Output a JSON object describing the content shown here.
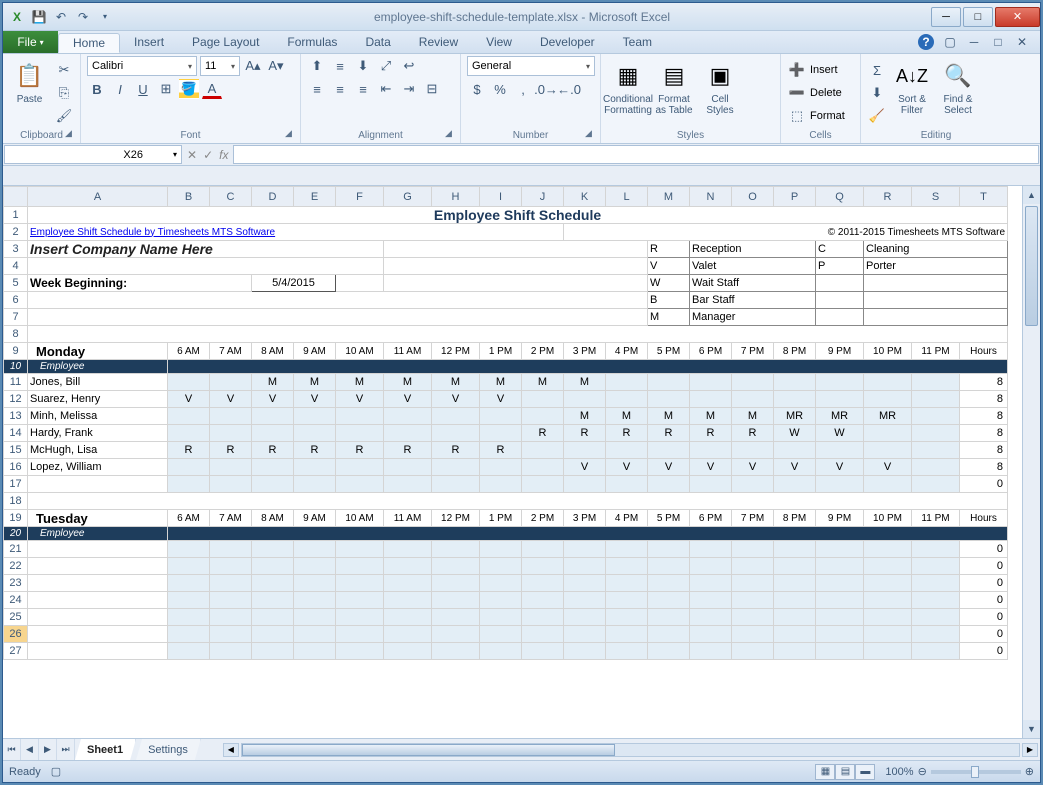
{
  "app": {
    "title": "employee-shift-schedule-template.xlsx - Microsoft Excel"
  },
  "ribbon": {
    "file": "File",
    "tabs": [
      "Home",
      "Insert",
      "Page Layout",
      "Formulas",
      "Data",
      "Review",
      "View",
      "Developer",
      "Team"
    ],
    "active": "Home",
    "clipboard_label": "Clipboard",
    "paste_label": "Paste",
    "font_label": "Font",
    "font_name": "Calibri",
    "font_size": "11",
    "alignment_label": "Alignment",
    "number_label": "Number",
    "number_format": "General",
    "styles_label": "Styles",
    "cond_fmt": "Conditional\nFormatting",
    "fmt_table": "Format\nas Table",
    "cell_styles": "Cell\nStyles",
    "cells_label": "Cells",
    "insert": "Insert",
    "delete": "Delete",
    "format": "Format",
    "editing_label": "Editing",
    "sortfilter": "Sort &\nFilter",
    "findselect": "Find &\nSelect"
  },
  "namebox": "X26",
  "sheet_tabs": [
    "Sheet1",
    "Settings"
  ],
  "status": {
    "ready": "Ready",
    "zoom": "100%"
  },
  "cols": [
    "A",
    "B",
    "C",
    "D",
    "E",
    "F",
    "G",
    "H",
    "I",
    "J",
    "K",
    "L",
    "M",
    "N",
    "O",
    "P",
    "Q",
    "R",
    "S",
    "T"
  ],
  "doc": {
    "title": "Employee Shift Schedule",
    "link": "Employee Shift Schedule by Timesheets MTS Software",
    "copyright": "© 2011-2015 Timesheets MTS Software",
    "company": "Insert Company Name Here",
    "week_label": "Week Beginning:",
    "week_date": "5/4/2015",
    "legend": [
      {
        "c": "R",
        "n": "Reception",
        "c2": "C",
        "n2": "Cleaning"
      },
      {
        "c": "V",
        "n": "Valet",
        "c2": "P",
        "n2": "Porter"
      },
      {
        "c": "W",
        "n": "Wait Staff",
        "c2": "",
        "n2": ""
      },
      {
        "c": "B",
        "n": "Bar Staff",
        "c2": "",
        "n2": ""
      },
      {
        "c": "M",
        "n": "Manager",
        "c2": "",
        "n2": ""
      }
    ],
    "times": [
      "6 AM",
      "7 AM",
      "8 AM",
      "9 AM",
      "10 AM",
      "11 AM",
      "12 PM",
      "1 PM",
      "2 PM",
      "3 PM",
      "4 PM",
      "5 PM",
      "6 PM",
      "7 PM",
      "8 PM",
      "9 PM",
      "10 PM",
      "11 PM"
    ],
    "hours_label": "Hours",
    "employee_label": "Employee",
    "days": [
      {
        "name": "Monday",
        "rows": [
          {
            "n": "Jones, Bill",
            "s": [
              "",
              "",
              "M",
              "M",
              "M",
              "M",
              "M",
              "M",
              "M",
              "M",
              "",
              "",
              "",
              "",
              "",
              "",
              "",
              ""
            ],
            "h": "8"
          },
          {
            "n": "Suarez, Henry",
            "s": [
              "V",
              "V",
              "V",
              "V",
              "V",
              "V",
              "V",
              "V",
              "",
              "",
              "",
              "",
              "",
              "",
              "",
              "",
              "",
              ""
            ],
            "h": "8"
          },
          {
            "n": "Minh, Melissa",
            "s": [
              "",
              "",
              "",
              "",
              "",
              "",
              "",
              "",
              "",
              "M",
              "M",
              "M",
              "M",
              "M",
              "MR",
              "MR",
              "MR",
              ""
            ],
            "h": "8"
          },
          {
            "n": "Hardy, Frank",
            "s": [
              "",
              "",
              "",
              "",
              "",
              "",
              "",
              "",
              "R",
              "R",
              "R",
              "R",
              "R",
              "R",
              "W",
              "W",
              "",
              ""
            ],
            "h": "8"
          },
          {
            "n": "McHugh, Lisa",
            "s": [
              "R",
              "R",
              "R",
              "R",
              "R",
              "R",
              "R",
              "R",
              "",
              "",
              "",
              "",
              "",
              "",
              "",
              "",
              "",
              ""
            ],
            "h": "8"
          },
          {
            "n": "Lopez, William",
            "s": [
              "",
              "",
              "",
              "",
              "",
              "",
              "",
              "",
              "",
              "V",
              "V",
              "V",
              "V",
              "V",
              "V",
              "V",
              "V",
              ""
            ],
            "h": "8"
          },
          {
            "n": "",
            "s": [
              "",
              "",
              "",
              "",
              "",
              "",
              "",
              "",
              "",
              "",
              "",
              "",
              "",
              "",
              "",
              "",
              "",
              ""
            ],
            "h": "0"
          }
        ]
      },
      {
        "name": "Tuesday",
        "rows": [
          {
            "n": "",
            "s": [
              "",
              "",
              "",
              "",
              "",
              "",
              "",
              "",
              "",
              "",
              "",
              "",
              "",
              "",
              "",
              "",
              "",
              ""
            ],
            "h": "0"
          },
          {
            "n": "",
            "s": [
              "",
              "",
              "",
              "",
              "",
              "",
              "",
              "",
              "",
              "",
              "",
              "",
              "",
              "",
              "",
              "",
              "",
              ""
            ],
            "h": "0"
          },
          {
            "n": "",
            "s": [
              "",
              "",
              "",
              "",
              "",
              "",
              "",
              "",
              "",
              "",
              "",
              "",
              "",
              "",
              "",
              "",
              "",
              ""
            ],
            "h": "0"
          },
          {
            "n": "",
            "s": [
              "",
              "",
              "",
              "",
              "",
              "",
              "",
              "",
              "",
              "",
              "",
              "",
              "",
              "",
              "",
              "",
              "",
              ""
            ],
            "h": "0"
          },
          {
            "n": "",
            "s": [
              "",
              "",
              "",
              "",
              "",
              "",
              "",
              "",
              "",
              "",
              "",
              "",
              "",
              "",
              "",
              "",
              "",
              ""
            ],
            "h": "0"
          },
          {
            "n": "",
            "s": [
              "",
              "",
              "",
              "",
              "",
              "",
              "",
              "",
              "",
              "",
              "",
              "",
              "",
              "",
              "",
              "",
              "",
              ""
            ],
            "h": "0"
          },
          {
            "n": "",
            "s": [
              "",
              "",
              "",
              "",
              "",
              "",
              "",
              "",
              "",
              "",
              "",
              "",
              "",
              "",
              "",
              "",
              "",
              ""
            ],
            "h": "0"
          }
        ]
      }
    ]
  }
}
